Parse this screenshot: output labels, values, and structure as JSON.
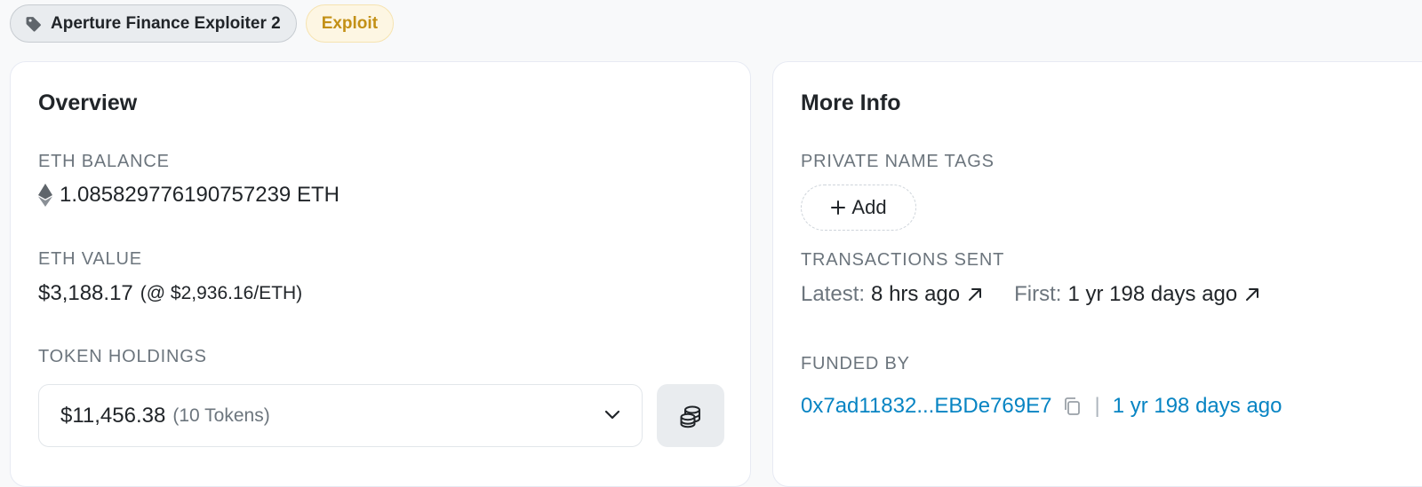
{
  "tags": {
    "name_tag": "Aperture Finance Exploiter 2",
    "name_tag_icon": "tag-icon",
    "exploit_tag": "Exploit"
  },
  "overview": {
    "title": "Overview",
    "eth_balance_label": "ETH BALANCE",
    "eth_balance_icon": "ethereum-icon",
    "eth_balance_value": "1.085829776190757239 ETH",
    "eth_value_label": "ETH VALUE",
    "eth_value": "$3,188.17",
    "eth_price": "(@ $2,936.16/ETH)",
    "token_holdings_label": "TOKEN HOLDINGS",
    "token_holdings_value": "$11,456.38",
    "token_holdings_count": "(10 Tokens)",
    "dropdown_icon": "chevron-down-icon",
    "token_button_icon": "coins-icon"
  },
  "more_info": {
    "title": "More Info",
    "private_tags_label": "PRIVATE NAME TAGS",
    "add_label": "Add",
    "add_icon": "plus-icon",
    "tx_sent_label": "TRANSACTIONS SENT",
    "latest_label": "Latest:",
    "latest_value": "8 hrs ago",
    "first_label": "First:",
    "first_value": "1 yr 198 days ago",
    "arrow_icon": "arrow-up-right-icon",
    "funded_by_label": "FUNDED BY",
    "funded_by_address": "0x7ad11832...EBDe769E7",
    "copy_icon": "copy-icon",
    "separator": "|",
    "funded_age": "1 yr 198 days ago"
  },
  "colors": {
    "link": "#0784c3",
    "exploit_text": "#c39016",
    "exploit_bg": "#fdf6e3",
    "muted": "#6c757d"
  }
}
